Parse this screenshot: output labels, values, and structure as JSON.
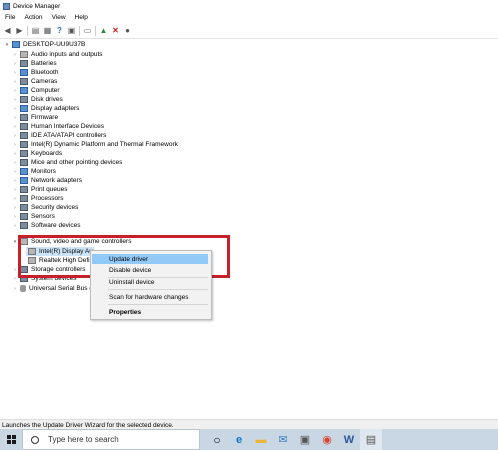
{
  "window": {
    "title": "Device Manager"
  },
  "menu": [
    "File",
    "Action",
    "View",
    "Help"
  ],
  "toolbar": {
    "icons": [
      "back-arrow-icon",
      "forward-arrow-icon",
      "show-hide-console-tree-icon",
      "properties-icon",
      "help-icon",
      "expand-icon",
      "scan-hardware-icon",
      "update-driver-icon",
      "uninstall-icon",
      "disable-icon"
    ]
  },
  "tree": {
    "root": "DESKTOP-UU9U37B",
    "items": [
      "Audio inputs and outputs",
      "Batteries",
      "Bluetooth",
      "Cameras",
      "Computer",
      "Disk drives",
      "Display adapters",
      "Firmware",
      "Human Interface Devices",
      "IDE ATA/ATAPI controllers",
      "Intel(R) Dynamic Platform and Thermal Framework",
      "Keyboards",
      "Mice and other pointing devices",
      "Monitors",
      "Network adapters",
      "Print queues",
      "Processors",
      "Security devices",
      "Sensors",
      "Software devices",
      "Sound, video and game controllers"
    ],
    "sound_children": [
      "Intel(R) Display Au",
      "Realtek High Defi"
    ],
    "after": [
      "Storage controllers",
      "System devices",
      "Universal Serial Bus co"
    ]
  },
  "context_menu": {
    "items": [
      "Update driver",
      "Disable device",
      "Uninstall device",
      "Scan for hardware changes",
      "Properties"
    ],
    "selected": "Update driver"
  },
  "status": {
    "text": "Launches the Update Driver Wizard for the selected device."
  },
  "taskbar": {
    "search_placeholder": "Type here to search",
    "apps": [
      "task-view-icon",
      "edge-icon",
      "file-explorer-icon",
      "mail-icon",
      "store-icon",
      "chrome-icon",
      "word-icon",
      "device-manager-icon"
    ]
  },
  "colors": {
    "highlight_border": "#c8202b",
    "selection": "#91c9f7",
    "taskbar": "#c9d6e3"
  }
}
